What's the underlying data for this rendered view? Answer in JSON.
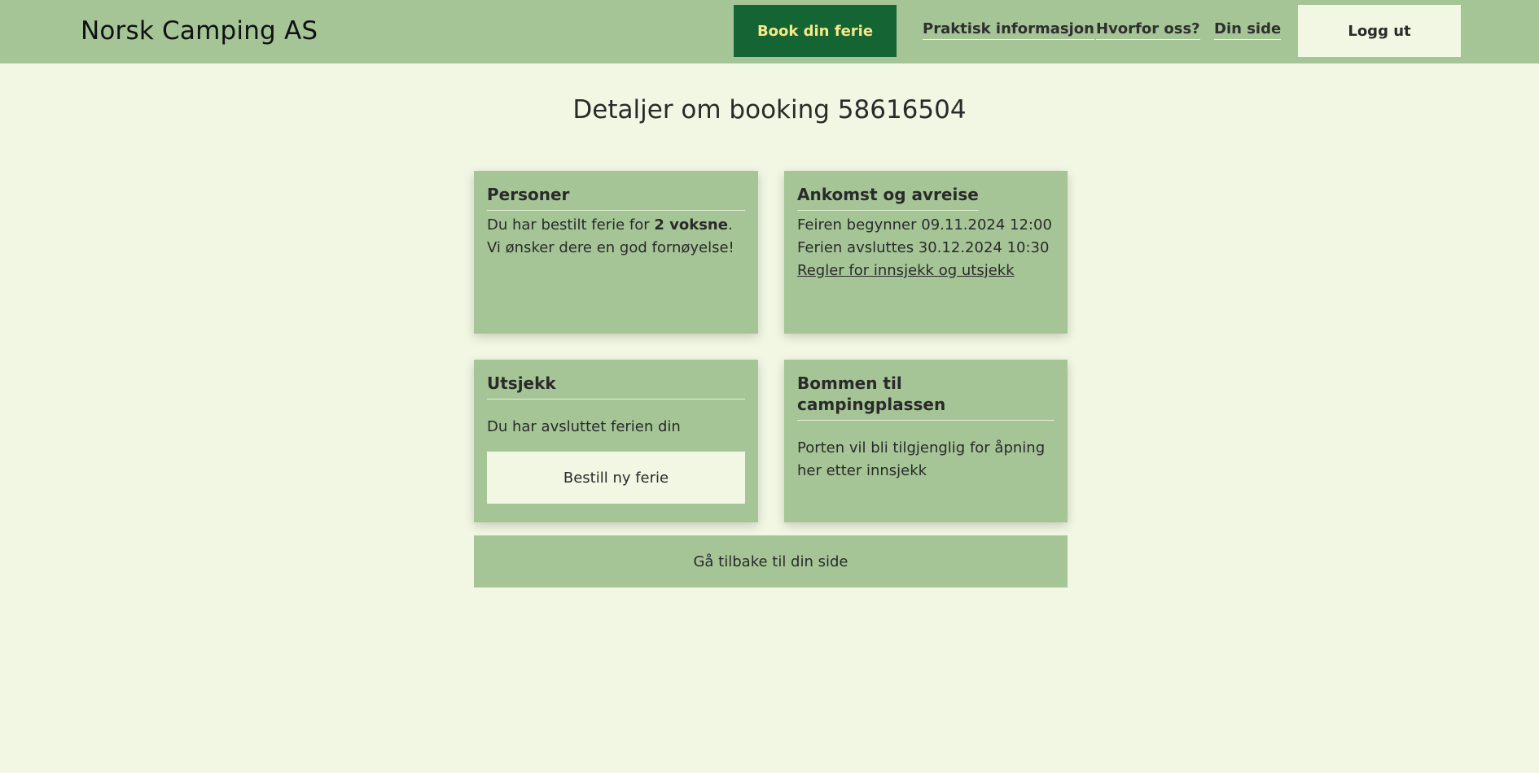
{
  "header": {
    "brand": "Norsk Camping AS",
    "book_label": "Book din ferie",
    "nav": {
      "praktisk": "Praktisk informasjon",
      "hvorfor": "Hvorfor oss?",
      "din_side": "Din side"
    },
    "logout_label": "Logg ut"
  },
  "page": {
    "title": "Detaljer om booking 58616504"
  },
  "cards": {
    "personer": {
      "title": "Personer",
      "text_before": "Du har bestilt ferie for ",
      "text_bold": "2 voksne",
      "text_after": ". Vi ønsker dere en god fornøyelse!"
    },
    "ankomst": {
      "title": "Ankomst og avreise",
      "start": "Feiren begynner 09.11.2024 12:00",
      "end": "Ferien avsluttes 30.12.2024 10:30",
      "rules_link": "Regler for innsjekk og utsjekk"
    },
    "utsjekk": {
      "title": "Utsjekk",
      "text": "Du har avsluttet ferien din",
      "button_label": "Bestill ny ferie"
    },
    "bommen": {
      "title": "Bommen til campingplassen",
      "text": "Porten vil bli tilgjenglig for åpning her etter innsjekk"
    }
  },
  "back_button_label": "Gå tilbake til din side",
  "colors": {
    "background": "#f2f7e3",
    "header_and_cards": "#a5c597",
    "book_button": "#146434",
    "book_button_text": "#f7e889"
  }
}
